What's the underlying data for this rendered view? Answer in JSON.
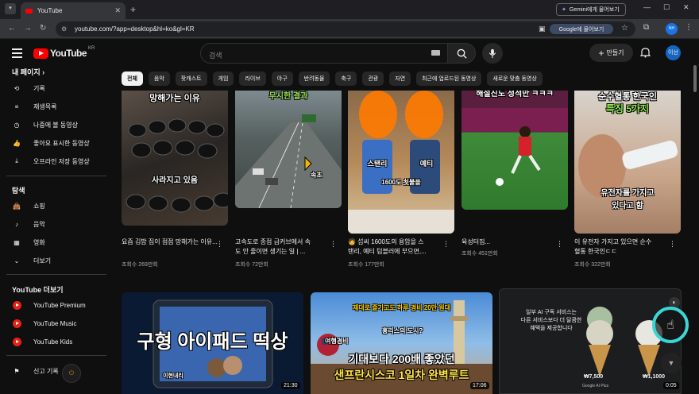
{
  "browser": {
    "tab_title": "YouTube",
    "url": "youtube.com/?app=desktop&hl=ko&gl=KR",
    "gemini_tab_button": "Gemini에게 물어보기",
    "gemini_pill": "Google에 물어보기",
    "profile_initial": "NH"
  },
  "header": {
    "logo_text": "YouTube",
    "region": "KR",
    "search_placeholder": "검색",
    "create_label": "만들기",
    "avatar_text": "이선"
  },
  "sidebar": {
    "my_page_heading": "내 페이지",
    "my_items": [
      {
        "label": "기록",
        "icon": "history-icon"
      },
      {
        "label": "재생목록",
        "icon": "playlist-icon"
      },
      {
        "label": "나중에 볼 동영상",
        "icon": "clock-icon"
      },
      {
        "label": "좋아요 표시한 동영상",
        "icon": "thumbs-up-icon"
      },
      {
        "label": "오프라인 저장 동영상",
        "icon": "download-icon"
      }
    ],
    "explore_heading": "탐색",
    "explore_items": [
      {
        "label": "쇼핑",
        "icon": "shopping-bag-icon"
      },
      {
        "label": "음악",
        "icon": "music-note-icon"
      },
      {
        "label": "영화",
        "icon": "film-icon"
      },
      {
        "label": "더보기",
        "icon": "chevron-down-icon"
      }
    ],
    "more_heading": "YouTube 더보기",
    "more_items": [
      {
        "label": "YouTube Premium"
      },
      {
        "label": "YouTube Music"
      },
      {
        "label": "YouTube Kids"
      }
    ],
    "report_label": "신고 기록"
  },
  "chips": [
    "전체",
    "음악",
    "팟캐스트",
    "게임",
    "라이브",
    "야구",
    "반려동물",
    "축구",
    "관광",
    "자연",
    "최근에 업로드된 동영상",
    "새로운 맞춤 동영상"
  ],
  "videos": [
    {
      "title1": "요즘 김밥 집이 점점 망해가는 이유...",
      "title2": "",
      "meta": "조회수 269만회",
      "cap_top": "망해가는 이유",
      "cap_mid": "사라지고 있음"
    },
    {
      "title1": "고속도로 종점 급커브에서 속",
      "title2": "도 안 줄이면 생기는 일 | ...",
      "meta": "조회수 72만회",
      "cap_top": "무시한 결과",
      "cap_mid": "속초"
    },
    {
      "title1": "🧑 섭씨 1600도의 용암을 스",
      "title2": "탠리, 예티 텀블러에 부으면,...",
      "meta": "조회수 177만회",
      "cap_top": "",
      "cap_mid": "스탠리",
      "cap_mid2": "예티",
      "cap_low": "1600도 쇳물을"
    },
    {
      "title1": "육성터짐...",
      "title2": "",
      "meta": "조회수 451만회",
      "cap_top": "해설진도 정적만 ㅋㅋㅋ"
    },
    {
      "title1": "이 유전자 가지고 있으면 순수",
      "title2": "혈통 한국인ㄷㄷ",
      "meta": "조회수 322만회",
      "cap_top": "순수혈통 한국인",
      "cap_top2": "특징 5가지",
      "cap_low": "유전자를 가지고",
      "cap_low2": "있다고 함"
    }
  ],
  "shorts": [
    {
      "cap": "구형 아이패드 떡상",
      "face": "이현내리",
      "duration": "21:30"
    },
    {
      "cap_top": "제대로 즐기고도 하루 경비 20만 원대",
      "cap_a": "여행경비",
      "cap_b": "홍리스의 도시?",
      "line1": "기대보다 200배 좋았던",
      "line2": "샌프란시스코 1일차 완벽루트",
      "duration": "17:06"
    },
    {
      "ad1": "일부 AI 구독 서비스는",
      "ad2": "다른 서비스보다 더 달콤한",
      "ad3": "혜택을 제공합니다",
      "price1": "₩7,500",
      "price2": "₩1,1000",
      "label1": "Google AI Plus",
      "label2": "",
      "duration": "0:05"
    }
  ],
  "colors": {
    "accent_red": "#ff0000",
    "bg": "#0f0f0f",
    "chip": "#272727"
  }
}
